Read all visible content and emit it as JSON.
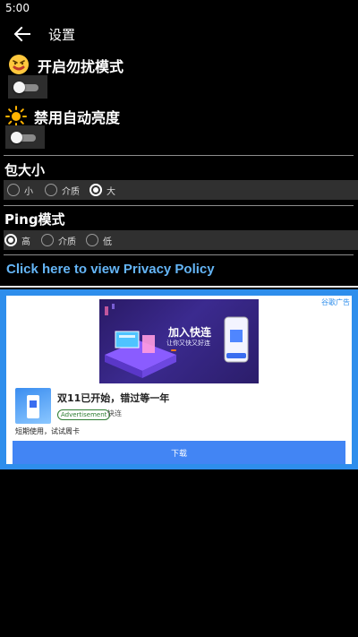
{
  "status_bar": {
    "time": "5:00"
  },
  "app_bar": {
    "title": "设置"
  },
  "settings": {
    "dnd_mode": {
      "title": "开启勿扰模式",
      "enabled": false
    },
    "auto_brightness": {
      "title": "禁用自动亮度",
      "enabled": false
    }
  },
  "package_size": {
    "title": "包大小",
    "options": [
      "小",
      "介质",
      "大"
    ],
    "selected": "大"
  },
  "ping_mode": {
    "title": "Ping模式",
    "options": [
      "高",
      "介质",
      "低"
    ],
    "selected": "高"
  },
  "privacy_link": "Click here to view Privacy Policy",
  "ad": {
    "choice_label": "谷歌广告",
    "banner_title": "加入快连",
    "banner_subtitle": "让你又快又好连",
    "headline": "双11已开始，错过等一年",
    "badge": "Advertisement",
    "advertiser": "快连",
    "body": "短期使用，试试周卡",
    "cta": "下载"
  },
  "colors": {
    "background": "#000000",
    "link": "#64b5f6",
    "ad_frame": "#2e8eec",
    "cta": "#4285f4",
    "radio_bar": "#303030"
  }
}
